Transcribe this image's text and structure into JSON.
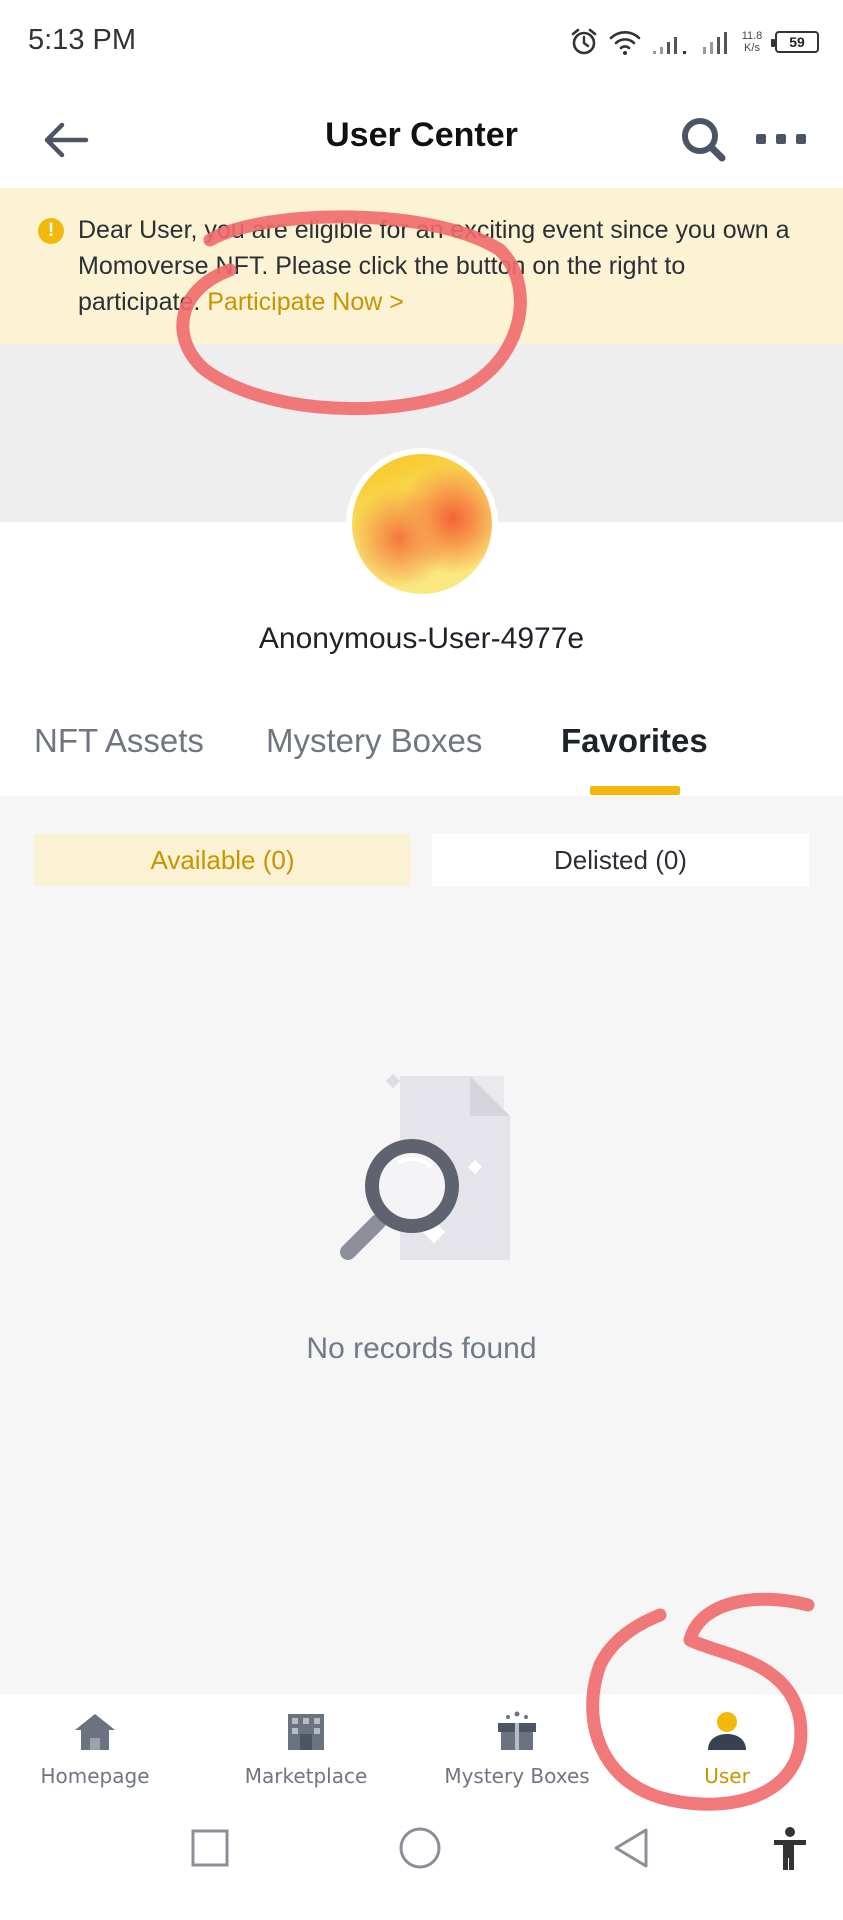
{
  "status_bar": {
    "time": "5:13 PM",
    "net_speed_value": "11.8",
    "net_speed_unit": "K/s",
    "battery": "59",
    "icons": [
      "alarm-icon",
      "wifi-icon",
      "signal-icon",
      "signal-icon",
      "battery-icon"
    ]
  },
  "header": {
    "title": "User Center",
    "icons": [
      "back-arrow-icon",
      "search-icon",
      "more-icon"
    ]
  },
  "notice": {
    "icon": "warning-icon",
    "text": "Dear User, you are eligible for an exciting event since you own a Momoverse NFT. Please click the button on the right to participate.",
    "link": "Participate Now >"
  },
  "profile": {
    "username": "Anonymous-User-4977e"
  },
  "tabs": [
    {
      "label": "NFT Assets",
      "active": false
    },
    {
      "label": "Mystery Boxes",
      "active": false
    },
    {
      "label": "Favorites",
      "active": true
    }
  ],
  "filters": {
    "available": "Available (0)",
    "delisted": "Delisted (0)",
    "selected": "available"
  },
  "empty_state": {
    "icon": "no-results-search-icon",
    "text": "No records found"
  },
  "bottom_nav": [
    {
      "label": "Homepage",
      "icon": "home-icon",
      "active": false
    },
    {
      "label": "Marketplace",
      "icon": "store-icon",
      "active": false
    },
    {
      "label": "Mystery Boxes",
      "icon": "gift-box-icon",
      "active": false
    },
    {
      "label": "User",
      "icon": "user-icon",
      "active": true
    }
  ],
  "system_nav": [
    "recents-square-icon",
    "home-circle-icon",
    "back-triangle-icon",
    "accessibility-icon"
  ],
  "colors": {
    "accent": "#f0b90b",
    "accent_text": "#c99400",
    "notice_bg": "#fbf3d3",
    "annotation": "#f16a6c"
  }
}
